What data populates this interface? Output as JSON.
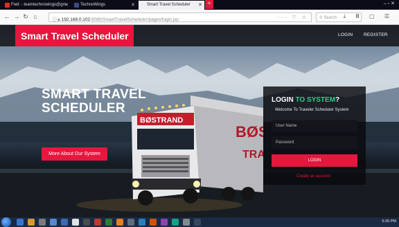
{
  "browser": {
    "tabs": [
      {
        "label": "Fwd: - teamtechnowings@gm",
        "active": false
      },
      {
        "label": "TechnoWings",
        "active": false
      },
      {
        "label": "Smart Travel Scheduler",
        "active": true
      }
    ],
    "url_host": "192.168.0.102",
    "url_path": ":8080/SmartTravelScheduler/pages/login.jsp",
    "url_icons": "··· ♡ ☆",
    "search_placeholder": "Search",
    "right_icons": "⤓ Ⅲ ▢ ☰",
    "win_controls": "‒ ▫ ✕"
  },
  "site": {
    "brand": "Smart Travel Scheduler",
    "nav": {
      "login": "LOGIN",
      "register": "REGISTER"
    },
    "headline_line1": "SMART TRAVEL",
    "headline_line2": "SCHEDULER",
    "about_button": "More About Our System",
    "login_panel": {
      "title_part1": "LOGIN",
      "title_part2": "TO SYSTEM",
      "title_part3": "?",
      "subtitle": "Welcome To Traveler Scheduler System",
      "username_placeholder": "User Name",
      "password_placeholder": "Password",
      "submit": "LOGIN",
      "create_link": "Create an account"
    },
    "truck_text": "BØSTRAND",
    "trailer_text": "BØS",
    "trailer_text2": "TRA"
  },
  "taskbar": {
    "clock": "5:25 PM"
  },
  "colors": {
    "accent_red": "#e5173f",
    "accent_green": "#2fcf8b"
  }
}
